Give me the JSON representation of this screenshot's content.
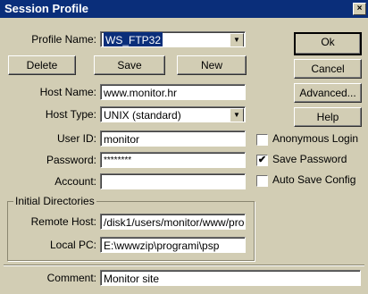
{
  "window": {
    "title": "Session Profile",
    "close_glyph": "×"
  },
  "profile": {
    "label": "Profile Name:",
    "value": "WS_FTP32"
  },
  "buttons": {
    "delete": "Delete",
    "save": "Save",
    "new": "New",
    "ok": "Ok",
    "cancel": "Cancel",
    "advanced": "Advanced...",
    "help": "Help"
  },
  "host_name": {
    "label": "Host Name:",
    "value": "www.monitor.hr"
  },
  "host_type": {
    "label": "Host Type:",
    "value": "UNIX (standard)"
  },
  "user_id": {
    "label": "User ID:",
    "value": "monitor"
  },
  "password": {
    "label": "Password:",
    "value": "********"
  },
  "account": {
    "label": "Account:",
    "value": ""
  },
  "checkboxes": {
    "anonymous": {
      "label": "Anonymous Login",
      "checked": false
    },
    "save_password": {
      "label": "Save Password",
      "checked": true
    },
    "auto_save": {
      "label": "Auto Save Config",
      "checked": false
    }
  },
  "initial_dirs": {
    "title": "Initial Directories",
    "remote_label": "Remote Host:",
    "remote_value": "/disk1/users/monitor/www/pro",
    "local_label": "Local PC:",
    "local_value": "E:\\wwwzip\\programi\\psp"
  },
  "comment": {
    "label": "Comment:",
    "value": "Monitor site"
  },
  "icons": {
    "dropdown": "▼",
    "check": "✔"
  }
}
